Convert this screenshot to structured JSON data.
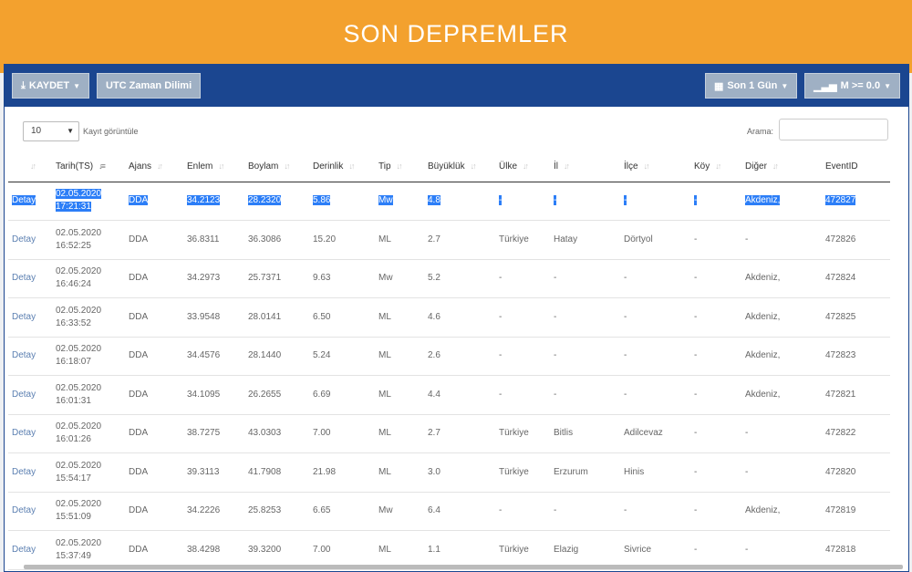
{
  "header": {
    "title": "SON DEPREMLER"
  },
  "toolbar": {
    "save_label": "KAYDET",
    "utc_label": "UTC Zaman Dilimi",
    "period_label": "Son 1 Gün",
    "magnitude_label": "M >= 0.0"
  },
  "controls": {
    "length_value": "10",
    "length_suffix": "Kayıt görüntüle",
    "search_label": "Arama:",
    "search_value": ""
  },
  "table": {
    "columns": [
      "",
      "Tarih(TS)",
      "Ajans",
      "Enlem",
      "Boylam",
      "Derinlik",
      "Tip",
      "Büyüklük",
      "Ülke",
      "İl",
      "İlçe",
      "Köy",
      "Diğer",
      "EventID"
    ],
    "rows": [
      {
        "detail": "Detay",
        "date": "02.05.2020",
        "time": "17:21:31",
        "agency": "DDA",
        "lat": "34.2123",
        "lon": "28.2320",
        "depth": "5.86",
        "type": "Mw",
        "mag": "4.8",
        "country": "-",
        "province": "-",
        "district": "-",
        "village": "-",
        "other": "Akdeniz,",
        "event": "472827"
      },
      {
        "detail": "Detay",
        "date": "02.05.2020",
        "time": "16:52:25",
        "agency": "DDA",
        "lat": "36.8311",
        "lon": "36.3086",
        "depth": "15.20",
        "type": "ML",
        "mag": "2.7",
        "country": "Türkiye",
        "province": "Hatay",
        "district": "Dörtyol",
        "village": "-",
        "other": "-",
        "event": "472826"
      },
      {
        "detail": "Detay",
        "date": "02.05.2020",
        "time": "16:46:24",
        "agency": "DDA",
        "lat": "34.2973",
        "lon": "25.7371",
        "depth": "9.63",
        "type": "Mw",
        "mag": "5.2",
        "country": "-",
        "province": "-",
        "district": "-",
        "village": "-",
        "other": "Akdeniz,",
        "event": "472824"
      },
      {
        "detail": "Detay",
        "date": "02.05.2020",
        "time": "16:33:52",
        "agency": "DDA",
        "lat": "33.9548",
        "lon": "28.0141",
        "depth": "6.50",
        "type": "ML",
        "mag": "4.6",
        "country": "-",
        "province": "-",
        "district": "-",
        "village": "-",
        "other": "Akdeniz,",
        "event": "472825"
      },
      {
        "detail": "Detay",
        "date": "02.05.2020",
        "time": "16:18:07",
        "agency": "DDA",
        "lat": "34.4576",
        "lon": "28.1440",
        "depth": "5.24",
        "type": "ML",
        "mag": "2.6",
        "country": "-",
        "province": "-",
        "district": "-",
        "village": "-",
        "other": "Akdeniz,",
        "event": "472823"
      },
      {
        "detail": "Detay",
        "date": "02.05.2020",
        "time": "16:01:31",
        "agency": "DDA",
        "lat": "34.1095",
        "lon": "26.2655",
        "depth": "6.69",
        "type": "ML",
        "mag": "4.4",
        "country": "-",
        "province": "-",
        "district": "-",
        "village": "-",
        "other": "Akdeniz,",
        "event": "472821"
      },
      {
        "detail": "Detay",
        "date": "02.05.2020",
        "time": "16:01:26",
        "agency": "DDA",
        "lat": "38.7275",
        "lon": "43.0303",
        "depth": "7.00",
        "type": "ML",
        "mag": "2.7",
        "country": "Türkiye",
        "province": "Bitlis",
        "district": "Adilcevaz",
        "village": "-",
        "other": "-",
        "event": "472822"
      },
      {
        "detail": "Detay",
        "date": "02.05.2020",
        "time": "15:54:17",
        "agency": "DDA",
        "lat": "39.3113",
        "lon": "41.7908",
        "depth": "21.98",
        "type": "ML",
        "mag": "3.0",
        "country": "Türkiye",
        "province": "Erzurum",
        "district": "Hinis",
        "village": "-",
        "other": "-",
        "event": "472820"
      },
      {
        "detail": "Detay",
        "date": "02.05.2020",
        "time": "15:51:09",
        "agency": "DDA",
        "lat": "34.2226",
        "lon": "25.8253",
        "depth": "6.65",
        "type": "Mw",
        "mag": "6.4",
        "country": "-",
        "province": "-",
        "district": "-",
        "village": "-",
        "other": "Akdeniz,",
        "event": "472819"
      },
      {
        "detail": "Detay",
        "date": "02.05.2020",
        "time": "15:37:49",
        "agency": "DDA",
        "lat": "38.4298",
        "lon": "39.3200",
        "depth": "7.00",
        "type": "ML",
        "mag": "1.1",
        "country": "Türkiye",
        "province": "Elazig",
        "district": "Sivrice",
        "village": "-",
        "other": "-",
        "event": "472818"
      }
    ]
  },
  "colors": {
    "banner": "#f3a12e",
    "toolbar": "#1b4690",
    "button": "#9fb0c4",
    "selection": "#2c7ef7"
  }
}
